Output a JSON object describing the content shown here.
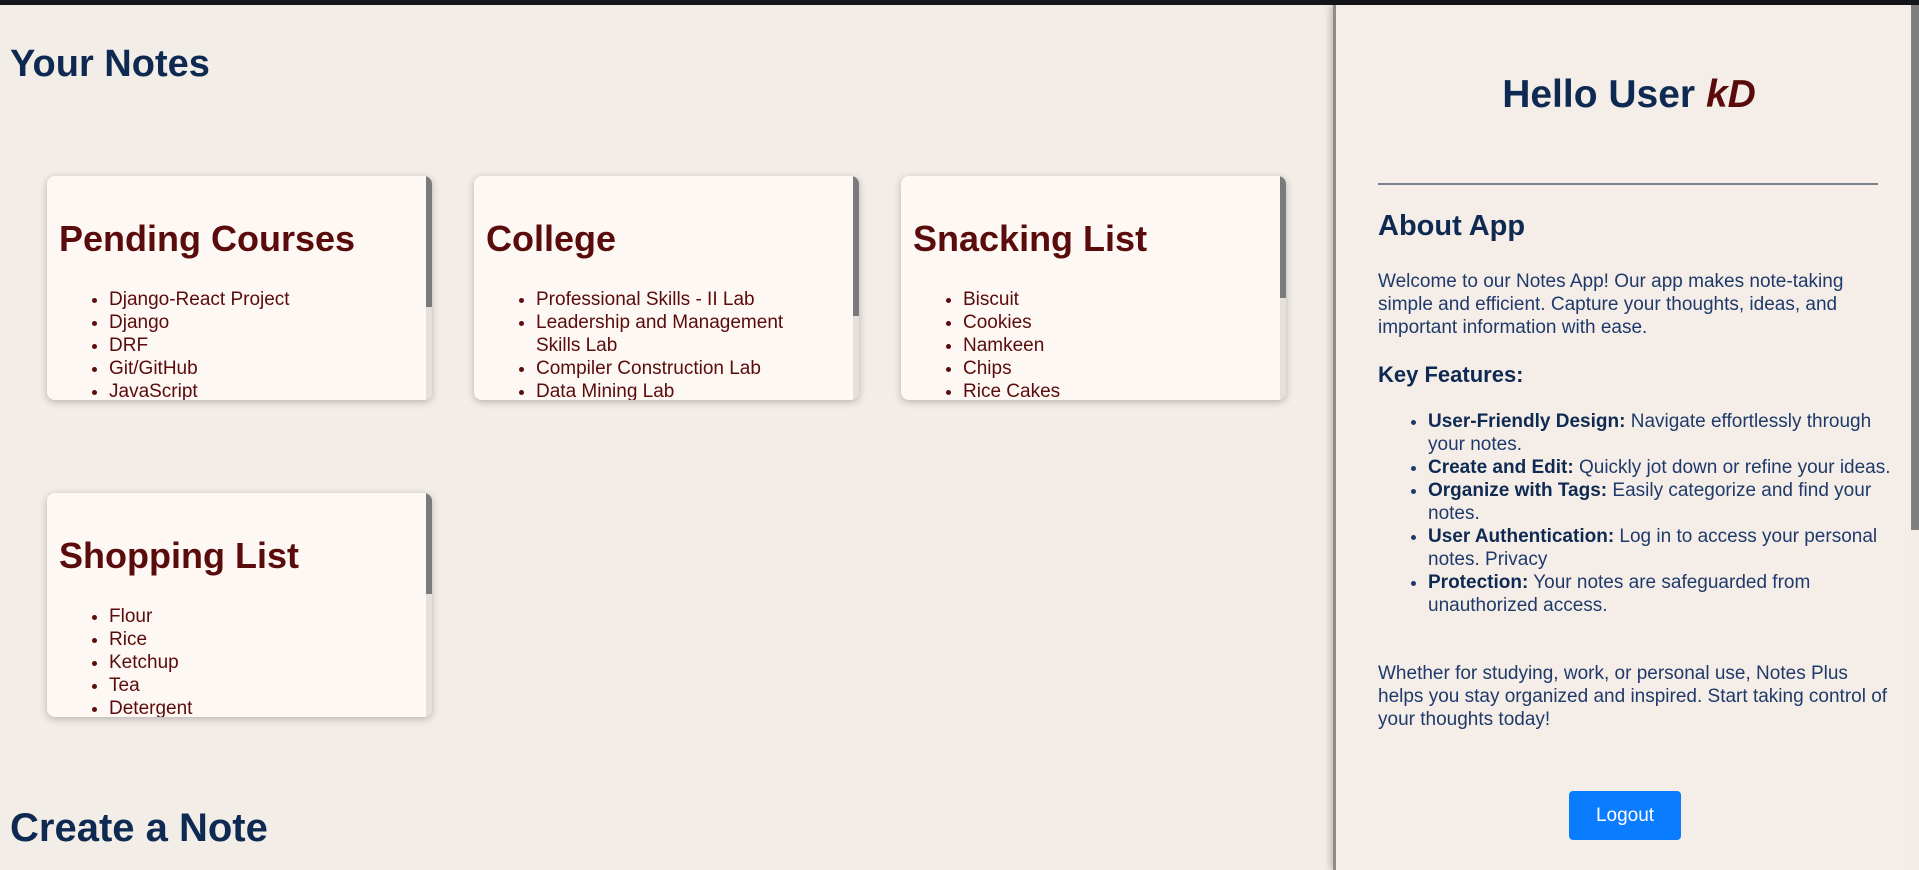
{
  "main": {
    "notes_title": "Your Notes",
    "create_title": "Create a Note",
    "notes": [
      {
        "title": "Pending Courses",
        "items": [
          "Django-React Project",
          "Django",
          "DRF",
          "Git/GitHub",
          "JavaScript"
        ]
      },
      {
        "title": "College",
        "items": [
          "Professional Skills - II Lab",
          "Leadership and Management Skills Lab",
          "Compiler Construction Lab",
          "Data Mining Lab"
        ]
      },
      {
        "title": "Snacking List",
        "items": [
          "Biscuit",
          "Cookies",
          "Namkeen",
          "Chips",
          "Rice Cakes"
        ]
      },
      {
        "title": "Shopping List",
        "items": [
          "Flour",
          "Rice",
          "Ketchup",
          "Tea",
          "Detergent"
        ]
      }
    ]
  },
  "sidebar": {
    "greeting": "Hello User",
    "username": "kD",
    "about_title": "About App",
    "about_text": "Welcome to our Notes App! Our app makes note-taking simple and efficient. Capture your thoughts, ideas, and important information with ease.",
    "key_features_title": "Key Features:",
    "features": [
      {
        "label": "User-Friendly Design:",
        "text": "Navigate effortlessly through your notes."
      },
      {
        "label": "Create and Edit:",
        "text": "Quickly jot down or refine your ideas."
      },
      {
        "label": "Organize with Tags:",
        "text": "Easily categorize and find your notes."
      },
      {
        "label": "User Authentication:",
        "text": "Log in to access your personal notes. Privacy"
      },
      {
        "label": "Protection:",
        "text": "Your notes are safeguarded from unauthorized access."
      }
    ],
    "closing_text": "Whether for studying, work, or personal use, Notes Plus helps you stay organized and inspired. Start taking control of your thoughts today!",
    "logout_label": "Logout"
  },
  "colors": {
    "background": "#f3ede7",
    "heading_navy": "#0f2a52",
    "note_maroon": "#5a0b0b",
    "button_blue": "#0a7cff"
  }
}
